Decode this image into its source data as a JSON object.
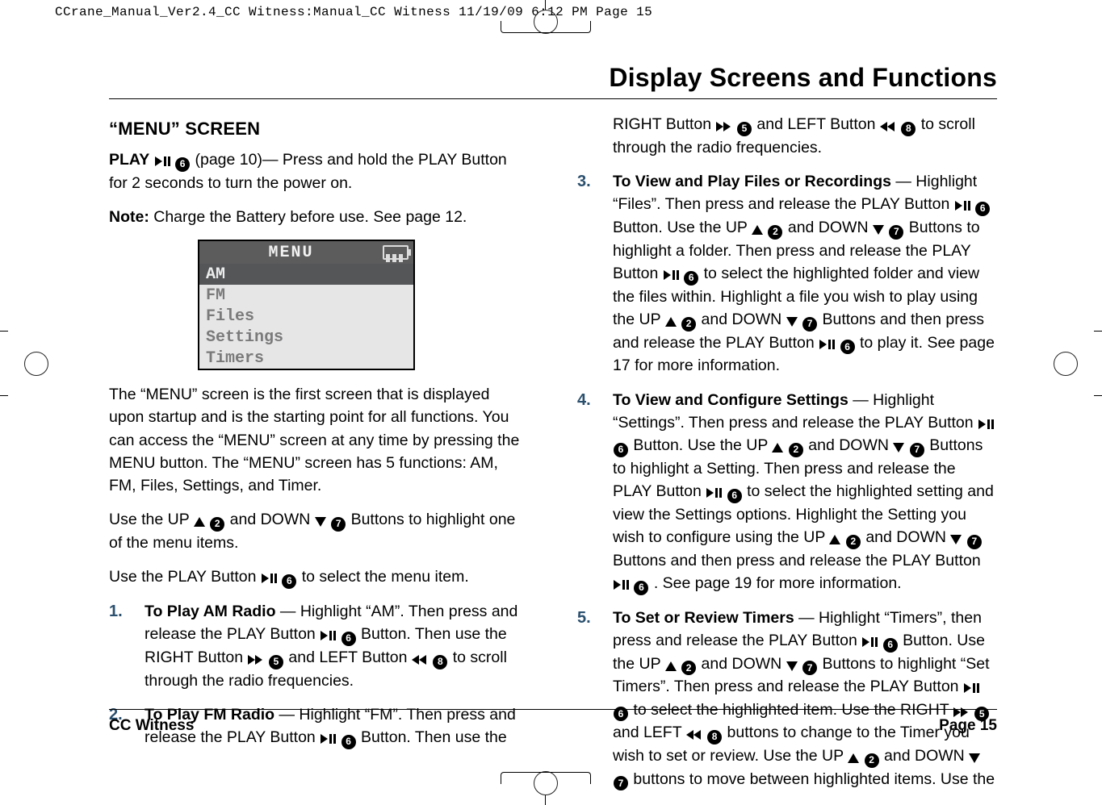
{
  "slug": "CCrane_Manual_Ver2.4_CC Witness:Manual_CC Witness  11/19/09  6:12 PM  Page 15",
  "header": {
    "title": "Display Screens and Functions"
  },
  "left": {
    "h2": "“MENU” SCREEN",
    "play_label": "PLAY",
    "play_tail": "(page 10)— Press and hold the PLAY Button for 2 seconds to turn the power on.",
    "note_label": "Note:",
    "note_text": "Charge the Battery before use. See page 12.",
    "menu": {
      "title": "MENU",
      "items": [
        "AM",
        "FM",
        "Files",
        "Settings",
        "Timers"
      ]
    },
    "p1": "The “MENU” screen is the first screen that is displayed upon startup and is the starting point for all functions. You can access the “MENU” screen at any time by pressing the MENU button. The “MENU” screen has 5 functions: AM, FM, Files, Settings, and Timer.",
    "p2a": "Use the UP ",
    "p2b": " and DOWN ",
    "p2c": " Buttons to highlight one of the menu items.",
    "p3a": "Use the PLAY Button ",
    "p3b": " to select the menu item.",
    "item1": {
      "num": "1.",
      "lead": "To Play AM Radio",
      "a": " — Highlight “AM”. Then press and release the PLAY Button ",
      "b": " Button. Then use the RIGHT Button ",
      "c": " and LEFT Button ",
      "d": " to scroll through the radio frequencies."
    },
    "item2": {
      "num": "2.",
      "lead": "To Play FM Radio",
      "a": " — Highlight “FM”. Then press and release the PLAY Button ",
      "b": " Button. Then use the"
    }
  },
  "right": {
    "cont_a": "RIGHT Button ",
    "cont_b": " and LEFT Button ",
    "cont_c": " to scroll through the radio frequencies.",
    "item3": {
      "num": "3.",
      "lead": "To View and Play Files or Recordings",
      "a": " — Highlight “Files”. Then press and release the PLAY Button ",
      "b": " Button. Use the UP ",
      "c": " and DOWN ",
      "d": " Buttons to highlight a folder. Then press and release the PLAY Button ",
      "e": " to select the highlighted folder and view the files within. Highlight a file you wish to play using the UP ",
      "f": " and DOWN ",
      "g": " Buttons and then press and release the PLAY Button ",
      "h": " to play it. See page 17 for more information."
    },
    "item4": {
      "num": "4.",
      "lead": "To View and Configure Settings",
      "a": " — Highlight “Settings”. Then press and release the PLAY Button ",
      "b": " Button. Use the UP ",
      "c": " and DOWN ",
      "d": " Buttons to highlight a Setting. Then press and release the PLAY Button ",
      "e": " to select the highlighted setting and view the Settings options. Highlight the Setting you wish to configure using the UP ",
      "f": " and DOWN ",
      "g": " Buttons and then press and release the PLAY Button ",
      "h": ". See page 19 for more information."
    },
    "item5": {
      "num": "5.",
      "lead": "To Set or Review Timers",
      "a": " — Highlight “Timers”, then press and release the PLAY Button ",
      "b": " Button. Use the UP ",
      "c": " and DOWN ",
      "d": " Buttons to highlight “Set Timers”. Then press and release the PLAY Button ",
      "e": " to select the highlighted item. Use the RIGHT ",
      "f": " and LEFT ",
      "g": " buttons to change to the Timer you wish to set or review. Use the UP ",
      "h": " and DOWN ",
      "i": " buttons to move between highlighted items. Use the"
    }
  },
  "labels": {
    "n2": "2",
    "n5": "5",
    "n6": "6",
    "n7": "7",
    "n8": "8"
  },
  "footer": {
    "left": "CC Witness",
    "right": "Page 15"
  }
}
